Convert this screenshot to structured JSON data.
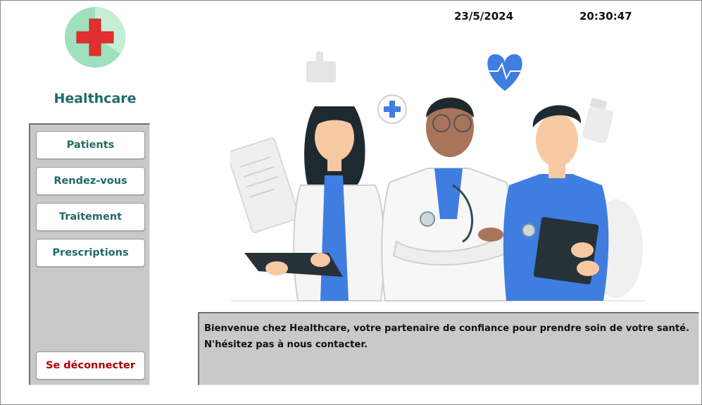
{
  "app": {
    "name": "Healthcare",
    "logo_icon": "medical-cross-icon"
  },
  "header": {
    "date": "23/5/2024",
    "time": "20:30:47"
  },
  "sidebar": {
    "items": [
      {
        "label": "Patients"
      },
      {
        "label": "Rendez-vous"
      },
      {
        "label": "Traitement"
      },
      {
        "label": "Prescriptions"
      }
    ],
    "logout_label": "Se déconnecter"
  },
  "welcome": {
    "line1": "Bienvenue chez Healthcare, votre partenaire de confiance pour prendre soin de votre santé.",
    "line2": "N'hésitez pas à nous contacter."
  },
  "colors": {
    "brand_text": "#1f6b66",
    "logout_text": "#b00000",
    "panel_bg": "#c9c9c9",
    "accent_blue": "#3f7de0"
  }
}
